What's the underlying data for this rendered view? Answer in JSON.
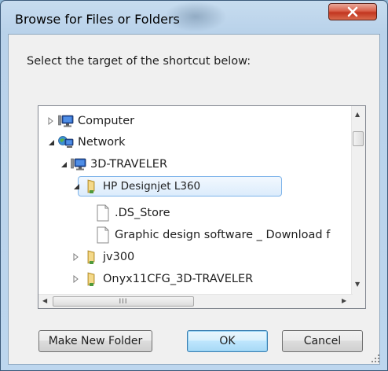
{
  "window": {
    "title": "Browse for Files or Folders",
    "close_label": "X"
  },
  "prompt": "Select the target of the shortcut below:",
  "tree": {
    "items": [
      {
        "label": "Computer",
        "icon": "computer-icon",
        "arrow": "collapsed",
        "selected": false
      },
      {
        "label": "Network",
        "icon": "network-icon",
        "arrow": "expanded",
        "selected": false
      },
      {
        "label": "3D-TRAVELER",
        "icon": "computer-icon",
        "arrow": "expanded",
        "selected": false
      },
      {
        "label": "HP Designjet L360",
        "icon": "shared-folder-icon",
        "arrow": "expanded",
        "selected": true
      },
      {
        "label": ".DS_Store",
        "icon": "file-icon",
        "arrow": "none",
        "selected": false
      },
      {
        "label": "Graphic design software _ Download f",
        "icon": "file-icon",
        "arrow": "none",
        "selected": false
      },
      {
        "label": "jv300",
        "icon": "shared-folder-icon",
        "arrow": "collapsed",
        "selected": false
      },
      {
        "label": "Onyx11CFG_3D-TRAVELER",
        "icon": "shared-folder-icon",
        "arrow": "collapsed",
        "selected": false
      }
    ],
    "hscroll_grip": "III"
  },
  "buttons": {
    "new_folder": "Make New Folder",
    "ok": "OK",
    "cancel": "Cancel"
  },
  "colors": {
    "frame": "#b9d2ea",
    "selection_border": "#7eb4ea",
    "close_button": "#c2351f"
  }
}
